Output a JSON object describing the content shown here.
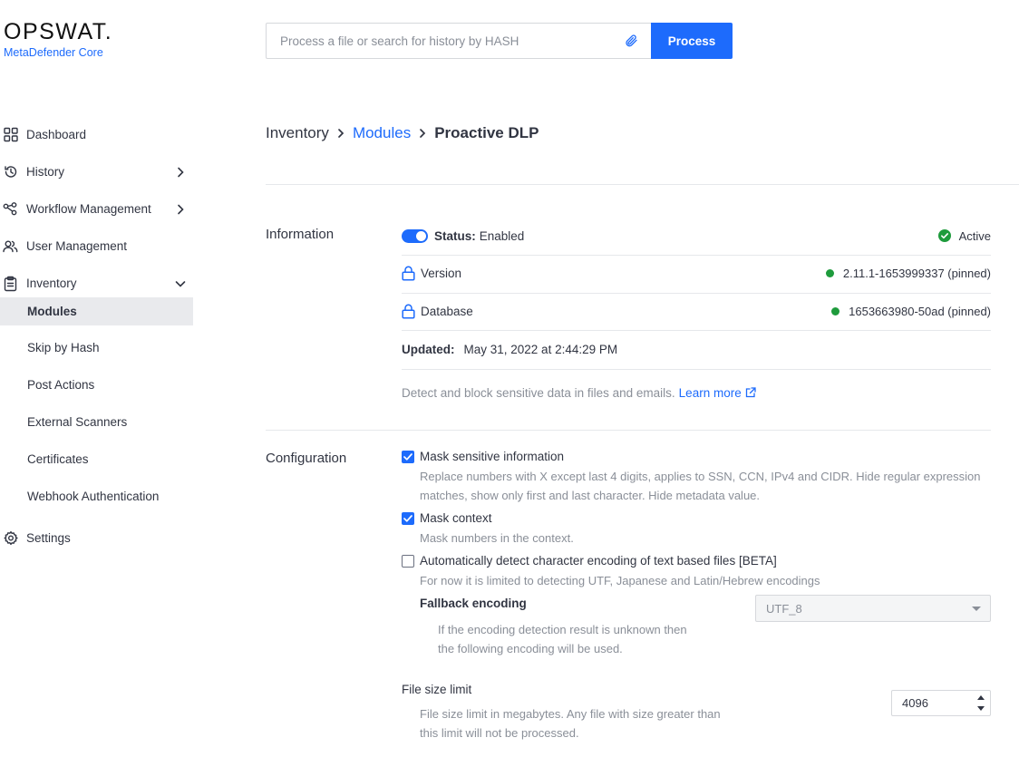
{
  "logo": {
    "wordmark": "OPSWAT.",
    "product": "MetaDefender Core"
  },
  "search": {
    "placeholder": "Process a file or search for history by HASH",
    "attach_icon": "paperclip-icon",
    "button_label": "Process"
  },
  "sidebar": {
    "items": [
      {
        "label": "Dashboard",
        "icon": "dashboard-grid-icon"
      },
      {
        "label": "History",
        "icon": "history-clock-icon"
      },
      {
        "label": "Workflow Management",
        "icon": "workflow-icon"
      },
      {
        "label": "User Management",
        "icon": "users-icon"
      },
      {
        "label": "Inventory",
        "icon": "clipboard-icon"
      }
    ],
    "inventory_sub": [
      "Modules",
      "Skip by Hash",
      "Post Actions",
      "External Scanners",
      "Certificates",
      "Webhook Authentication"
    ],
    "settings": {
      "label": "Settings",
      "icon": "gear-icon"
    }
  },
  "breadcrumb": {
    "home": "Inventory",
    "link": "Modules",
    "current": "Proactive DLP"
  },
  "information": {
    "title": "Information",
    "status_label": "Status:",
    "status_value": "Enabled",
    "active_label": "Active",
    "version_label": "Version",
    "version_value": "2.11.1-1653999337 (pinned)",
    "database_label": "Database",
    "database_value": "1653663980-50ad (pinned)",
    "updated_label": "Updated:",
    "updated_value": "May 31, 2022 at 2:44:29 PM",
    "description": "Detect and block sensitive data in files and emails.",
    "learn_more": "Learn more"
  },
  "configuration": {
    "title": "Configuration",
    "mask_sensitive": {
      "label": "Mask sensitive information",
      "checked": true,
      "desc_line1": "Replace numbers with X except last 4 digits, applies to SSN, CCN, IPv4 and CIDR. Hide regular expression",
      "desc_line2": "matches, show only first and last character. Hide metadata value."
    },
    "mask_context": {
      "label": "Mask context",
      "checked": true,
      "desc": "Mask numbers in the context."
    },
    "auto_detect": {
      "label": "Automatically detect character encoding of text based files [BETA]",
      "checked": false,
      "desc": "For now it is limited to detecting UTF, Japanese and Latin/Hebrew encodings"
    },
    "fallback": {
      "label": "Fallback encoding",
      "desc_line1": "If the encoding detection result is unknown then",
      "desc_line2": "the following encoding will be used.",
      "selected": "UTF_8"
    },
    "file_size": {
      "label": "File size limit",
      "desc_line1": "File size limit in megabytes. Any file with size greater than",
      "desc_line2": "this limit will not be processed.",
      "value": "4096"
    }
  },
  "colors": {
    "accent": "#1d6bfc",
    "active_green": "#1e9b3c",
    "text": "#313542",
    "muted": "#8a8f98"
  }
}
